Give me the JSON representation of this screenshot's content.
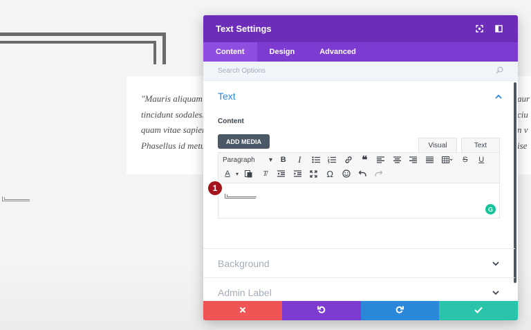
{
  "background": {
    "quote_lines": [
      "\"Mauris aliquam l",
      "tincidunt sodales.",
      "quam vitae sapien",
      "Phasellus id metu"
    ],
    "quote_right": [
      "aur",
      "ciu",
      "n v",
      "ise"
    ]
  },
  "modal": {
    "title": "Text Settings",
    "tabs": [
      {
        "label": "Content",
        "active": true
      },
      {
        "label": "Design",
        "active": false
      },
      {
        "label": "Advanced",
        "active": false
      }
    ],
    "search_placeholder": "Search Options",
    "text_section": {
      "title": "Text",
      "content_label": "Content",
      "add_media_label": "ADD MEDIA",
      "editor_tabs": [
        "Visual",
        "Text"
      ],
      "paragraph_select": "Paragraph",
      "marker_number": "1",
      "grammarly_letter": "G"
    },
    "sections": [
      {
        "title": "Background"
      },
      {
        "title": "Admin Label"
      }
    ]
  },
  "colors": {
    "header": "#6c2eb9",
    "tabs": "#7d3bd2",
    "active_tab": "#8f4ee0",
    "accent": "#2b87da",
    "cancel": "#ef5555",
    "undo": "#7e3bd0",
    "redo": "#2b87da",
    "save": "#29c4a9"
  }
}
